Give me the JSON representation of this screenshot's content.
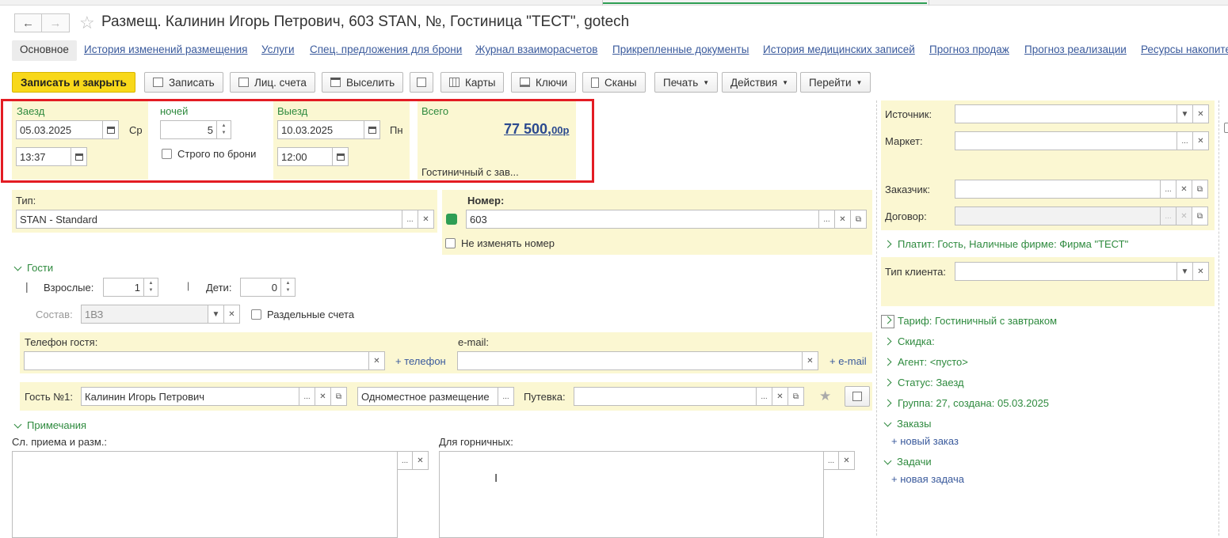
{
  "window": {
    "title": "Размещ. Калинин Игорь Петрович, 603 STAN, №, Гостиница \"ТЕСТ\", gotech"
  },
  "nav_tabs": [
    "Основное",
    "История изменений размещения",
    "Услуги",
    "Спец. предложения для брони",
    "Журнал взаиморасчетов",
    "Прикрепленные документы",
    "История медицинских записей",
    "Прогноз продаж",
    "Прогноз реализации",
    "Ресурсы накопите"
  ],
  "toolbar": {
    "save_close": "Записать и закрыть",
    "save": "Записать",
    "accounts": "Лиц. счета",
    "checkout": "Выселить",
    "cards": "Карты",
    "keys": "Ключи",
    "scans": "Сканы",
    "print": "Печать",
    "actions": "Действия",
    "goto": "Перейти"
  },
  "stay": {
    "arrival_label": "Заезд",
    "arrival_date": "05.03.2025",
    "arrival_weekday": "Ср",
    "arrival_time": "13:37",
    "nights_label": "ночей",
    "nights": "5",
    "strict_label": "Строго по брони",
    "departure_label": "Выезд",
    "departure_date": "10.03.2025",
    "departure_weekday": "Пн",
    "departure_time": "12:00",
    "total_label": "Всего",
    "total_main": "77 500,",
    "total_cents": "00",
    "total_currency": "р",
    "tariff_short": "Гостиничный с зав..."
  },
  "room": {
    "type_label": "Тип:",
    "type_value": "STAN - Standard",
    "number_label": "Номер:",
    "number_value": "603",
    "keep_number": "Не изменять номер"
  },
  "guests": {
    "section": "Гости",
    "adults_label": "Взрослые:",
    "adults": "1",
    "children_label": "Дети:",
    "children": "0",
    "composition_label": "Состав:",
    "composition_value": "1ВЗ",
    "separate_accounts": "Раздельные счета",
    "phone_label": "Телефон гостя:",
    "add_phone": "+ телефон",
    "email_label": "e-mail:",
    "add_email": "+ e-mail",
    "guest_label": "Гость №1:",
    "guest_name": "Калинин Игорь Петрович",
    "accommodation": "Одноместное размещение",
    "voucher_label": "Путевка:"
  },
  "notes": {
    "section": "Примечания",
    "reception_label": "Сл. приема и разм.:",
    "housekeeping_label": "Для горничных:"
  },
  "right": {
    "source_label": "Источник:",
    "marker_label": "Маркет:",
    "customer_label": "Заказчик:",
    "contract_label": "Договор:",
    "payer": "Платит: Гость, Наличные фирме: Фирма \"ТЕСТ\"",
    "client_type_label": "Тип клиента:",
    "tariff": "Тариф: Гостиничный с завтраком",
    "discount": "Скидка:",
    "agent": "Агент: <пусто>",
    "status": "Статус: Заезд",
    "group": "Группа: 27, создана: 05.03.2025",
    "orders": "Заказы",
    "new_order": "+ новый заказ",
    "tasks": "Задачи",
    "new_task": "+ новая задача"
  },
  "colors": {
    "accent_green": "#2e8a3e",
    "link_blue": "#3a5a9c",
    "highlight_red": "#e31c23",
    "save_yellow": "#f8d81a",
    "panel_yellow": "#fbf7d2"
  }
}
